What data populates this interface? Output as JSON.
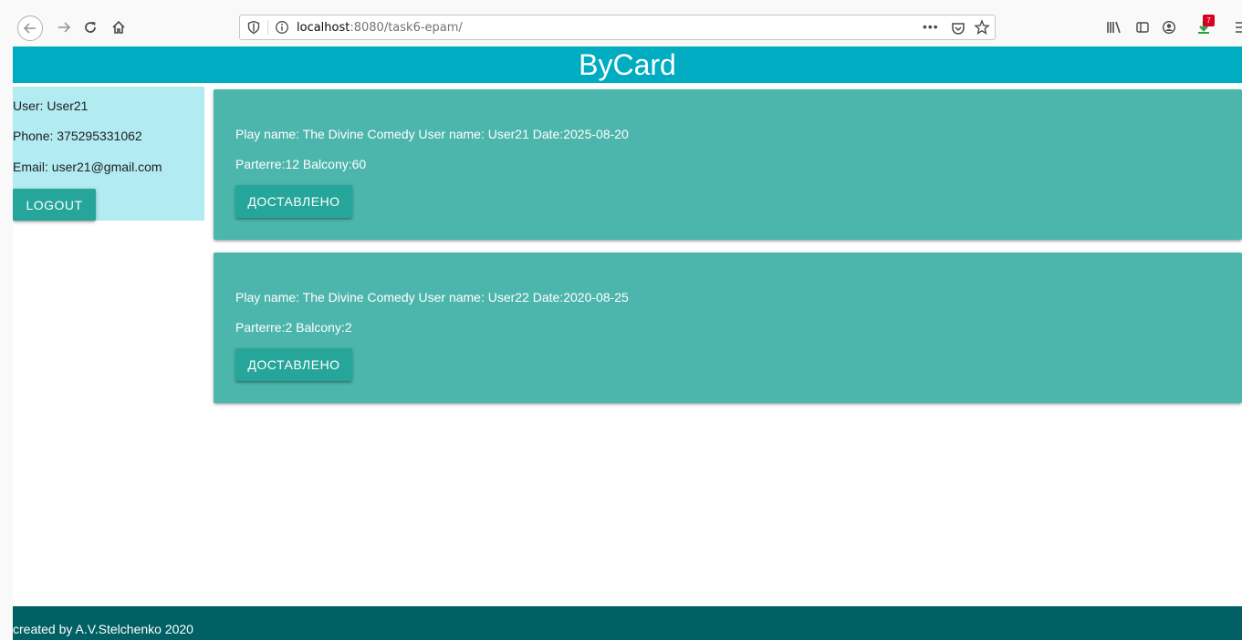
{
  "browser": {
    "url_host": "localhost",
    "url_rest": ":8080/task6-epam/",
    "page_actions": "•••",
    "extension_badge": "7"
  },
  "header": {
    "title": "ByCard"
  },
  "user": {
    "name_line": "User: User21",
    "phone_line": "Phone: 375295331062",
    "email_line": "Email: user21@gmail.com",
    "logout_label": "LOGOUT"
  },
  "orders": [
    {
      "info": "Play name: The Divine Comedy User name: User21 Date:2025-08-20",
      "seats": "Parterre:12 Balcony:60",
      "button_label": "ДОСТАВЛЕНО"
    },
    {
      "info": "Play name: The Divine Comedy User name: User22 Date:2020-08-25",
      "seats": "Parterre:2 Balcony:2",
      "button_label": "ДОСТАВЛЕНО"
    }
  ],
  "footer": {
    "text": "created by A.V.Stelchenko 2020"
  },
  "colors": {
    "header": "#00acc1",
    "user_panel": "#b2ebf2",
    "card": "#4db6ac",
    "button": "#26a69a",
    "footer": "#006064"
  }
}
